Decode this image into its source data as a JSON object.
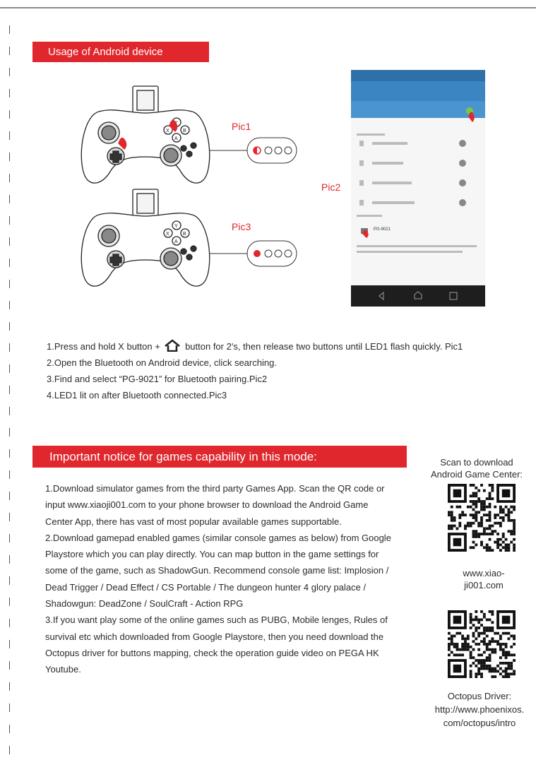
{
  "banners": {
    "android": "Usage of Android device",
    "notice": "Important notice for games capability in this mode:"
  },
  "pics": {
    "pic1": "Pic1",
    "pic2": "Pic2",
    "pic3": "Pic3",
    "phone_device": "PG-9021"
  },
  "instructions": {
    "step1_before": "1.Press and hold X button +",
    "step1_after": "button for 2's, then release two buttons until LED1 flash quickly. Pic1",
    "step2": "2.Open the Bluetooth on Android device, click searching.",
    "step3": "3.Find and select “PG-9021” for Bluetooth pairing.Pic2",
    "step4": "4.LED1 lit on after Bluetooth connected.Pic3"
  },
  "notice": {
    "p1": "1.Download simulator games from the third party Games App. Scan the QR code or input www.xiaoji001.com to your phone browser to download the Android Game Center App, there has vast of most popular available games supportable.",
    "p2": "2.Download gamepad enabled games (similar console games as below) from Google Playstore which you can play directly. You can map button in the game settings for some of the game, such as ShadowGun. Recommend console game list: Implosion / Dead Trigger / Dead Effect / CS Portable / The dungeon hunter 4 glory palace / Shadowgun: DeadZone / SoulCraft - Action RPG",
    "p3": "3.If you want play some of the online games such as PUBG, Mobile lenges, Rules of survival etc which downloaded from Google Playstore, then you need download the Octopus driver for buttons mapping, check the operation guide video on PEGA HK Youtube."
  },
  "side": {
    "scan_title_1": "Scan to download",
    "scan_title_2": "Android Game Center:",
    "url1_line1": "www.xiao-",
    "url1_line2": "ji001.com",
    "octopus_title": "Octopus Driver:",
    "url2_line1": "http://www.phoenixos.",
    "url2_line2": "com/octopus/intro"
  },
  "colors": {
    "accent": "#e0272d"
  }
}
